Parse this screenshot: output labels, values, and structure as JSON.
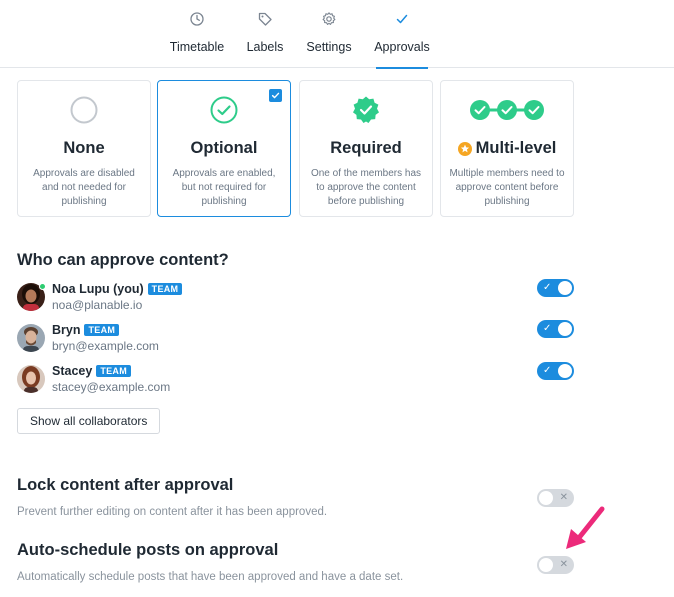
{
  "tabs": [
    {
      "label": "Timetable",
      "icon": "clock-icon"
    },
    {
      "label": "Labels",
      "icon": "tag-icon"
    },
    {
      "label": "Settings",
      "icon": "gear-icon"
    },
    {
      "label": "Approvals",
      "icon": "check-icon",
      "active": true
    }
  ],
  "cards": [
    {
      "title": "None",
      "desc": "Approvals are disabled and not needed for publishing",
      "icon": "empty-circle-icon"
    },
    {
      "title": "Optional",
      "desc": "Approvals are enabled, but not required for publishing",
      "icon": "check-circle-icon",
      "selected": true
    },
    {
      "title": "Required",
      "desc": "One of the members has to approve the content before publishing",
      "icon": "badge-check-icon"
    },
    {
      "title": "Multi-level",
      "desc": "Multiple members need to approve content before publishing",
      "icon": "chain-check-icon"
    }
  ],
  "approvers": {
    "title": "Who can approve content?",
    "members": [
      {
        "name": "Noa Lupu (you)",
        "badge": "TEAM",
        "email": "noa@planable.io",
        "enabled": true
      },
      {
        "name": "Bryn",
        "badge": "TEAM",
        "email": "bryn@example.com",
        "enabled": true
      },
      {
        "name": "Stacey",
        "badge": "TEAM",
        "email": "stacey@example.com",
        "enabled": true
      }
    ],
    "show_all_label": "Show all collaborators"
  },
  "lock": {
    "title": "Lock content after approval",
    "desc": "Prevent further editing on content after it has been approved.",
    "enabled": false
  },
  "autoschedule": {
    "title": "Auto-schedule posts on approval",
    "desc": "Automatically schedule posts that have been approved and have a date set.",
    "enabled": false
  },
  "toggle_marks": {
    "on": "✓",
    "off": "✕"
  },
  "colors": {
    "accent": "#1c8cde",
    "success": "#2ecc8a",
    "annotation_arrow": "#ec2a7a"
  }
}
